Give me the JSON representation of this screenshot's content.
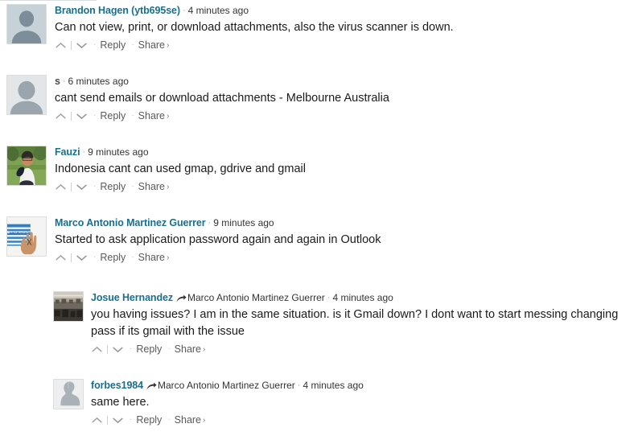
{
  "page": {
    "title": "Comment thread",
    "accent_link_color": "#1a6e8e",
    "body_text_color": "#1a1a1a",
    "meta_text_color": "#333333",
    "action_text_color": "#5a5a5a",
    "background": "#ffffff"
  },
  "actions": {
    "upvote_icon": "chevron-up-icon",
    "downvote_icon": "chevron-down-icon",
    "reply_label": "Reply",
    "share_label": "Share",
    "share_chevron": "›",
    "separator_dot": "·"
  },
  "meta": {
    "separator_dot": "·",
    "reply_arrow_icon": "reply-arrow-icon"
  },
  "comments": [
    {
      "id": "c1",
      "author": "Brandon Hagen (ytb695se)",
      "author_is_link": true,
      "timestamp": "4 minutes ago",
      "text": "Can not view, print, or download attachments, also the virus scanner is down.",
      "avatar_type": "default-silhouette-blue",
      "is_reply": false
    },
    {
      "id": "c2",
      "author": "s",
      "author_is_link": false,
      "timestamp": "6 minutes ago",
      "text": "cant send emails or download attachments - Melbourne Australia",
      "avatar_type": "default-silhouette-gray",
      "is_reply": false
    },
    {
      "id": "c3",
      "author": "Fauzi",
      "author_is_link": true,
      "timestamp": "9 minutes ago",
      "text": "Indonesia cant can used gmap, gdrive and gmail",
      "avatar_type": "photo-man-in-field",
      "is_reply": false
    },
    {
      "id": "c4",
      "author": "Marco Antonio Martinez Guerrer",
      "author_is_link": true,
      "timestamp": "9 minutes ago",
      "text": "Started to ask application password again and again in Outlook",
      "avatar_type": "photo-hand-banner",
      "is_reply": false
    },
    {
      "id": "c5",
      "author": "Josue Hernandez",
      "author_is_link": true,
      "reply_to": "Marco Antonio Martinez Guerrer",
      "timestamp": "4 minutes ago",
      "text": "you having issues? I am in the same situation. is it Gmail down? I dont want to start messing changing pass if its gmail with the issue",
      "avatar_type": "photo-indoor-scene",
      "is_reply": true
    },
    {
      "id": "c6",
      "author": "forbes1984",
      "author_is_link": true,
      "reply_to": "Marco Antonio Martinez Guerrer",
      "timestamp": "4 minutes ago",
      "text": "same here.",
      "avatar_type": "default-silhouette-profile",
      "is_reply": true
    }
  ]
}
